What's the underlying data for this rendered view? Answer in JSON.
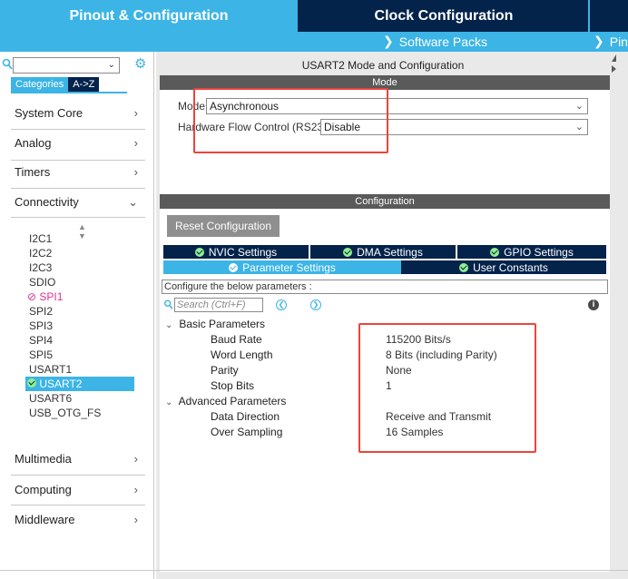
{
  "top_tabs": {
    "pinout": "Pinout & Configuration",
    "clock": "Clock Configuration"
  },
  "sub_bar": {
    "software_packs": "Software Packs",
    "pinout": "Pinout"
  },
  "left": {
    "category_tabs": [
      "Categories",
      "A->Z"
    ],
    "categories": [
      {
        "label": "System Core",
        "chevron": ">"
      },
      {
        "label": "Analog",
        "chevron": ">"
      },
      {
        "label": "Timers",
        "chevron": ">"
      },
      {
        "label": "Connectivity",
        "chevron": "v"
      },
      {
        "label": "Multimedia",
        "chevron": ">"
      },
      {
        "label": "Computing",
        "chevron": ">"
      },
      {
        "label": "Middleware",
        "chevron": ">"
      }
    ],
    "peripherals": [
      "I2C1",
      "I2C2",
      "I2C3",
      "SDIO",
      "SPI1",
      "SPI2",
      "SPI3",
      "SPI4",
      "SPI5",
      "USART1",
      "USART2",
      "USART6",
      "USB_OTG_FS"
    ],
    "warning_peripheral": "SPI1",
    "selected_peripheral": "USART2"
  },
  "mode": {
    "title": "USART2 Mode and Configuration",
    "header": "Mode",
    "mode_label": "Mode",
    "mode_value": "Asynchronous",
    "flow_label": "Hardware Flow Control (RS232)",
    "flow_value": "Disable"
  },
  "configuration": {
    "header": "Configuration",
    "reset_button": "Reset Configuration",
    "tabs_row1": [
      "NVIC Settings",
      "DMA Settings",
      "GPIO Settings"
    ],
    "tabs_row2": [
      "Parameter Settings",
      "User Constants"
    ],
    "configure_text": "Configure the below parameters :",
    "search_placeholder": "Search (Ctrl+F)",
    "basic_group": "Basic Parameters",
    "advanced_group": "Advanced Parameters",
    "params": [
      {
        "name": "Baud Rate",
        "value": "115200 Bits/s"
      },
      {
        "name": "Word Length",
        "value": "8 Bits (including Parity)"
      },
      {
        "name": "Parity",
        "value": "None"
      },
      {
        "name": "Stop Bits",
        "value": "1"
      },
      {
        "name": "Data Direction",
        "value": "Receive and Transmit"
      },
      {
        "name": "Over Sampling",
        "value": "16 Samples"
      }
    ]
  },
  "colors": {
    "accent": "#3cb4e6",
    "navy": "#03234b",
    "highlight_box": "#e8453c",
    "warning_pink": "#e0308c"
  }
}
